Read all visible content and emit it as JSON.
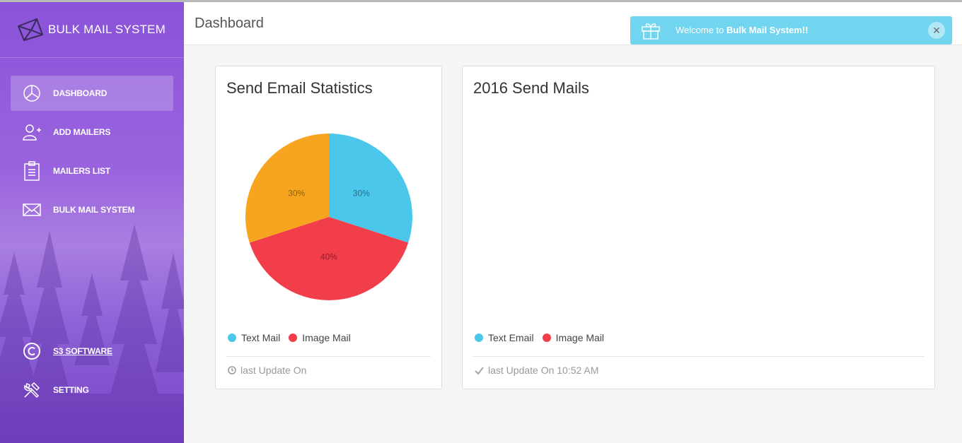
{
  "sidebar": {
    "brand": "BULK MAIL SYSTEM",
    "items": [
      {
        "label": "DASHBOARD",
        "icon": "pie-chart-icon"
      },
      {
        "label": "ADD MAILERS",
        "icon": "add-user-icon"
      },
      {
        "label": "MAILERS LIST",
        "icon": "clipboard-list-icon"
      },
      {
        "label": "BULK MAIL SYSTEM",
        "icon": "envelope-icon"
      },
      {
        "label": "S3 SOFTWARE",
        "icon": "copyright-icon"
      },
      {
        "label": "SETTING",
        "icon": "tools-icon"
      }
    ],
    "colors": {
      "top": "#8a53d9",
      "bottom": "#7a45c9"
    }
  },
  "header": {
    "title": "Dashboard",
    "toast": {
      "prefix": "Welcome to ",
      "strong": "Bulk Mail System!!",
      "icon": "gift-icon"
    }
  },
  "stats_card": {
    "title": "Send Email Statistics",
    "legend": [
      "Text Mail",
      "Image Mail"
    ],
    "footer": "last Update On",
    "footer_icon": "clock-icon"
  },
  "mails_card": {
    "title": "2016 Send Mails",
    "legend": [
      "Text Email",
      "Image Mail"
    ],
    "footer": "last Update On 10:52 AM",
    "footer_icon": "check-icon"
  },
  "chart_data": {
    "type": "pie",
    "title": "Send Email Statistics",
    "slices": [
      {
        "label": "30%",
        "value": 30,
        "color": "#4ac7ea"
      },
      {
        "label": "40%",
        "value": 40,
        "color": "#f23e4b"
      },
      {
        "label": "30%",
        "value": 30,
        "color": "#f7a51e"
      }
    ],
    "legend": [
      {
        "name": "Text Mail",
        "color": "#4ac7ea"
      },
      {
        "name": "Image Mail",
        "color": "#f23e4b"
      }
    ],
    "legend_position": "bottom-left"
  }
}
